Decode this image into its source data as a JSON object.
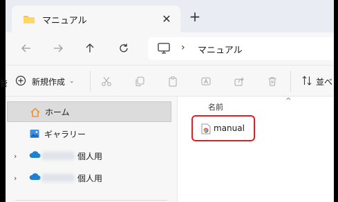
{
  "tab": {
    "title": "マニュアル",
    "close_glyph": "✕",
    "new_tab_glyph": "+"
  },
  "address": {
    "location": "マニュアル",
    "separator": "›"
  },
  "toolbar": {
    "new_label": "新規作成",
    "new_caret": "⌄",
    "sort_label": "並べ",
    "stray_char": "管"
  },
  "nav_pane": {
    "items": [
      {
        "label": "ホーム",
        "selected": true
      },
      {
        "label": "ギャラリー",
        "selected": false
      },
      {
        "label": "個人用",
        "selected": false
      },
      {
        "label": "個人用",
        "selected": false
      }
    ],
    "chevron": "›"
  },
  "file_list": {
    "column_name": "名前",
    "sort_caret": "^",
    "files": [
      {
        "name": "manual"
      }
    ]
  },
  "colors": {
    "accent": "#0067c0",
    "highlight_border": "#e02020",
    "selection": "#dcdcdc"
  }
}
